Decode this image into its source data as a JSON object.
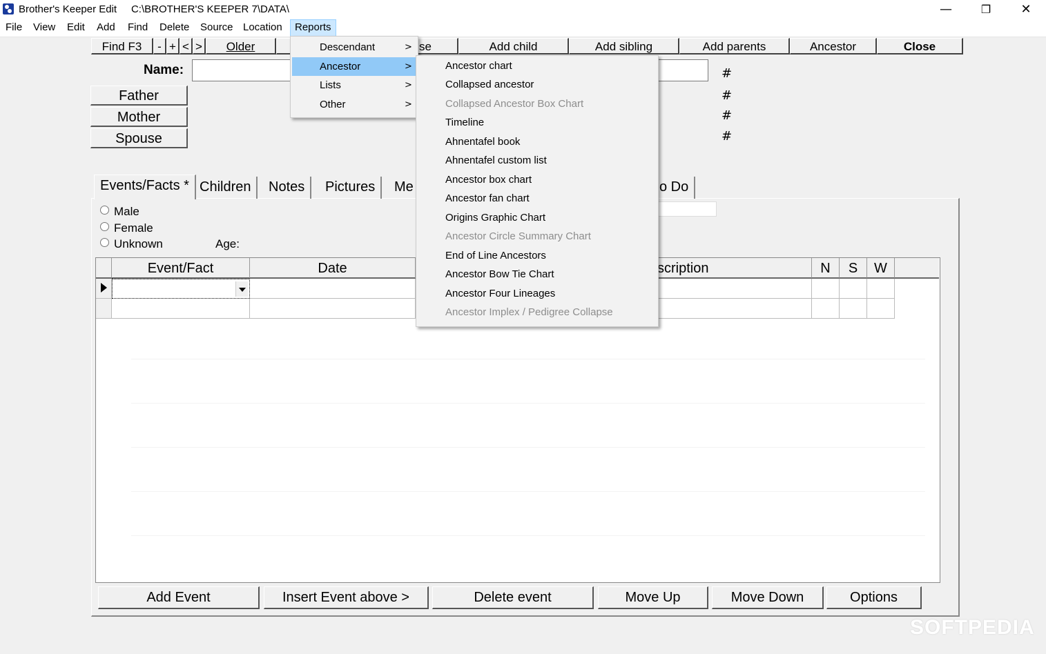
{
  "window": {
    "title": "Brother's Keeper Edit",
    "path": "C:\\BROTHER'S KEEPER 7\\DATA\\",
    "minimize": "—",
    "maximize": "❐",
    "close": "✕"
  },
  "menubar": [
    "File",
    "View",
    "Edit",
    "Add",
    "Find",
    "Delete",
    "Source",
    "Location",
    "Reports"
  ],
  "toolbar": {
    "find": "Find  F3",
    "minus": "-",
    "plus": "+",
    "prev": "<",
    "next": ">",
    "older": "Older",
    "spouse_partial": "se",
    "add_child": "Add child",
    "add_sibling": "Add sibling",
    "add_parents": "Add parents",
    "ancestor": "Ancestor",
    "close": "Close"
  },
  "person": {
    "name_label": "Name:",
    "father": "Father",
    "mother": "Mother",
    "spouse": "Spouse",
    "hash": "#"
  },
  "tabs": {
    "events": "Events/Facts *",
    "children": "Children",
    "notes": "Notes",
    "pictures": "Pictures",
    "media_partial": "Me",
    "todo_partial": "o Do"
  },
  "sex": {
    "male": "Male",
    "female": "Female",
    "unknown": "Unknown",
    "age": "Age:"
  },
  "grid": {
    "col_event": "Event/Fact",
    "col_date": "Date",
    "col_desc_partial": "scription",
    "col_n": "N",
    "col_s": "S",
    "col_w": "W"
  },
  "bottom_buttons": {
    "add_event": "Add Event",
    "insert_event": "Insert Event above >",
    "delete_event": "Delete event",
    "move_up": "Move Up",
    "move_down": "Move Down",
    "options": "Options"
  },
  "reports_menu": {
    "items": [
      "Descendant",
      "Ancestor",
      "Lists",
      "Other"
    ],
    "chevron": ">"
  },
  "ancestor_submenu": [
    {
      "label": "Ancestor chart",
      "enabled": true
    },
    {
      "label": "Collapsed ancestor",
      "enabled": true
    },
    {
      "label": "Collapsed Ancestor Box Chart",
      "enabled": false
    },
    {
      "label": "Timeline",
      "enabled": true
    },
    {
      "label": "Ahnentafel book",
      "enabled": true
    },
    {
      "label": "Ahnentafel custom list",
      "enabled": true
    },
    {
      "label": "Ancestor box chart",
      "enabled": true
    },
    {
      "label": "Ancestor fan chart",
      "enabled": true
    },
    {
      "label": "Origins Graphic Chart",
      "enabled": true
    },
    {
      "label": "Ancestor Circle Summary Chart",
      "enabled": false
    },
    {
      "label": "End of Line Ancestors",
      "enabled": true
    },
    {
      "label": "Ancestor Bow Tie Chart",
      "enabled": true
    },
    {
      "label": "Ancestor Four Lineages",
      "enabled": true
    },
    {
      "label": "Ancestor Implex / Pedigree Collapse",
      "enabled": false
    }
  ],
  "watermark": "SOFTPEDIA",
  "colors": {
    "menu_highlight": "#91c9f7",
    "disabled_text": "#8d8d8d"
  }
}
